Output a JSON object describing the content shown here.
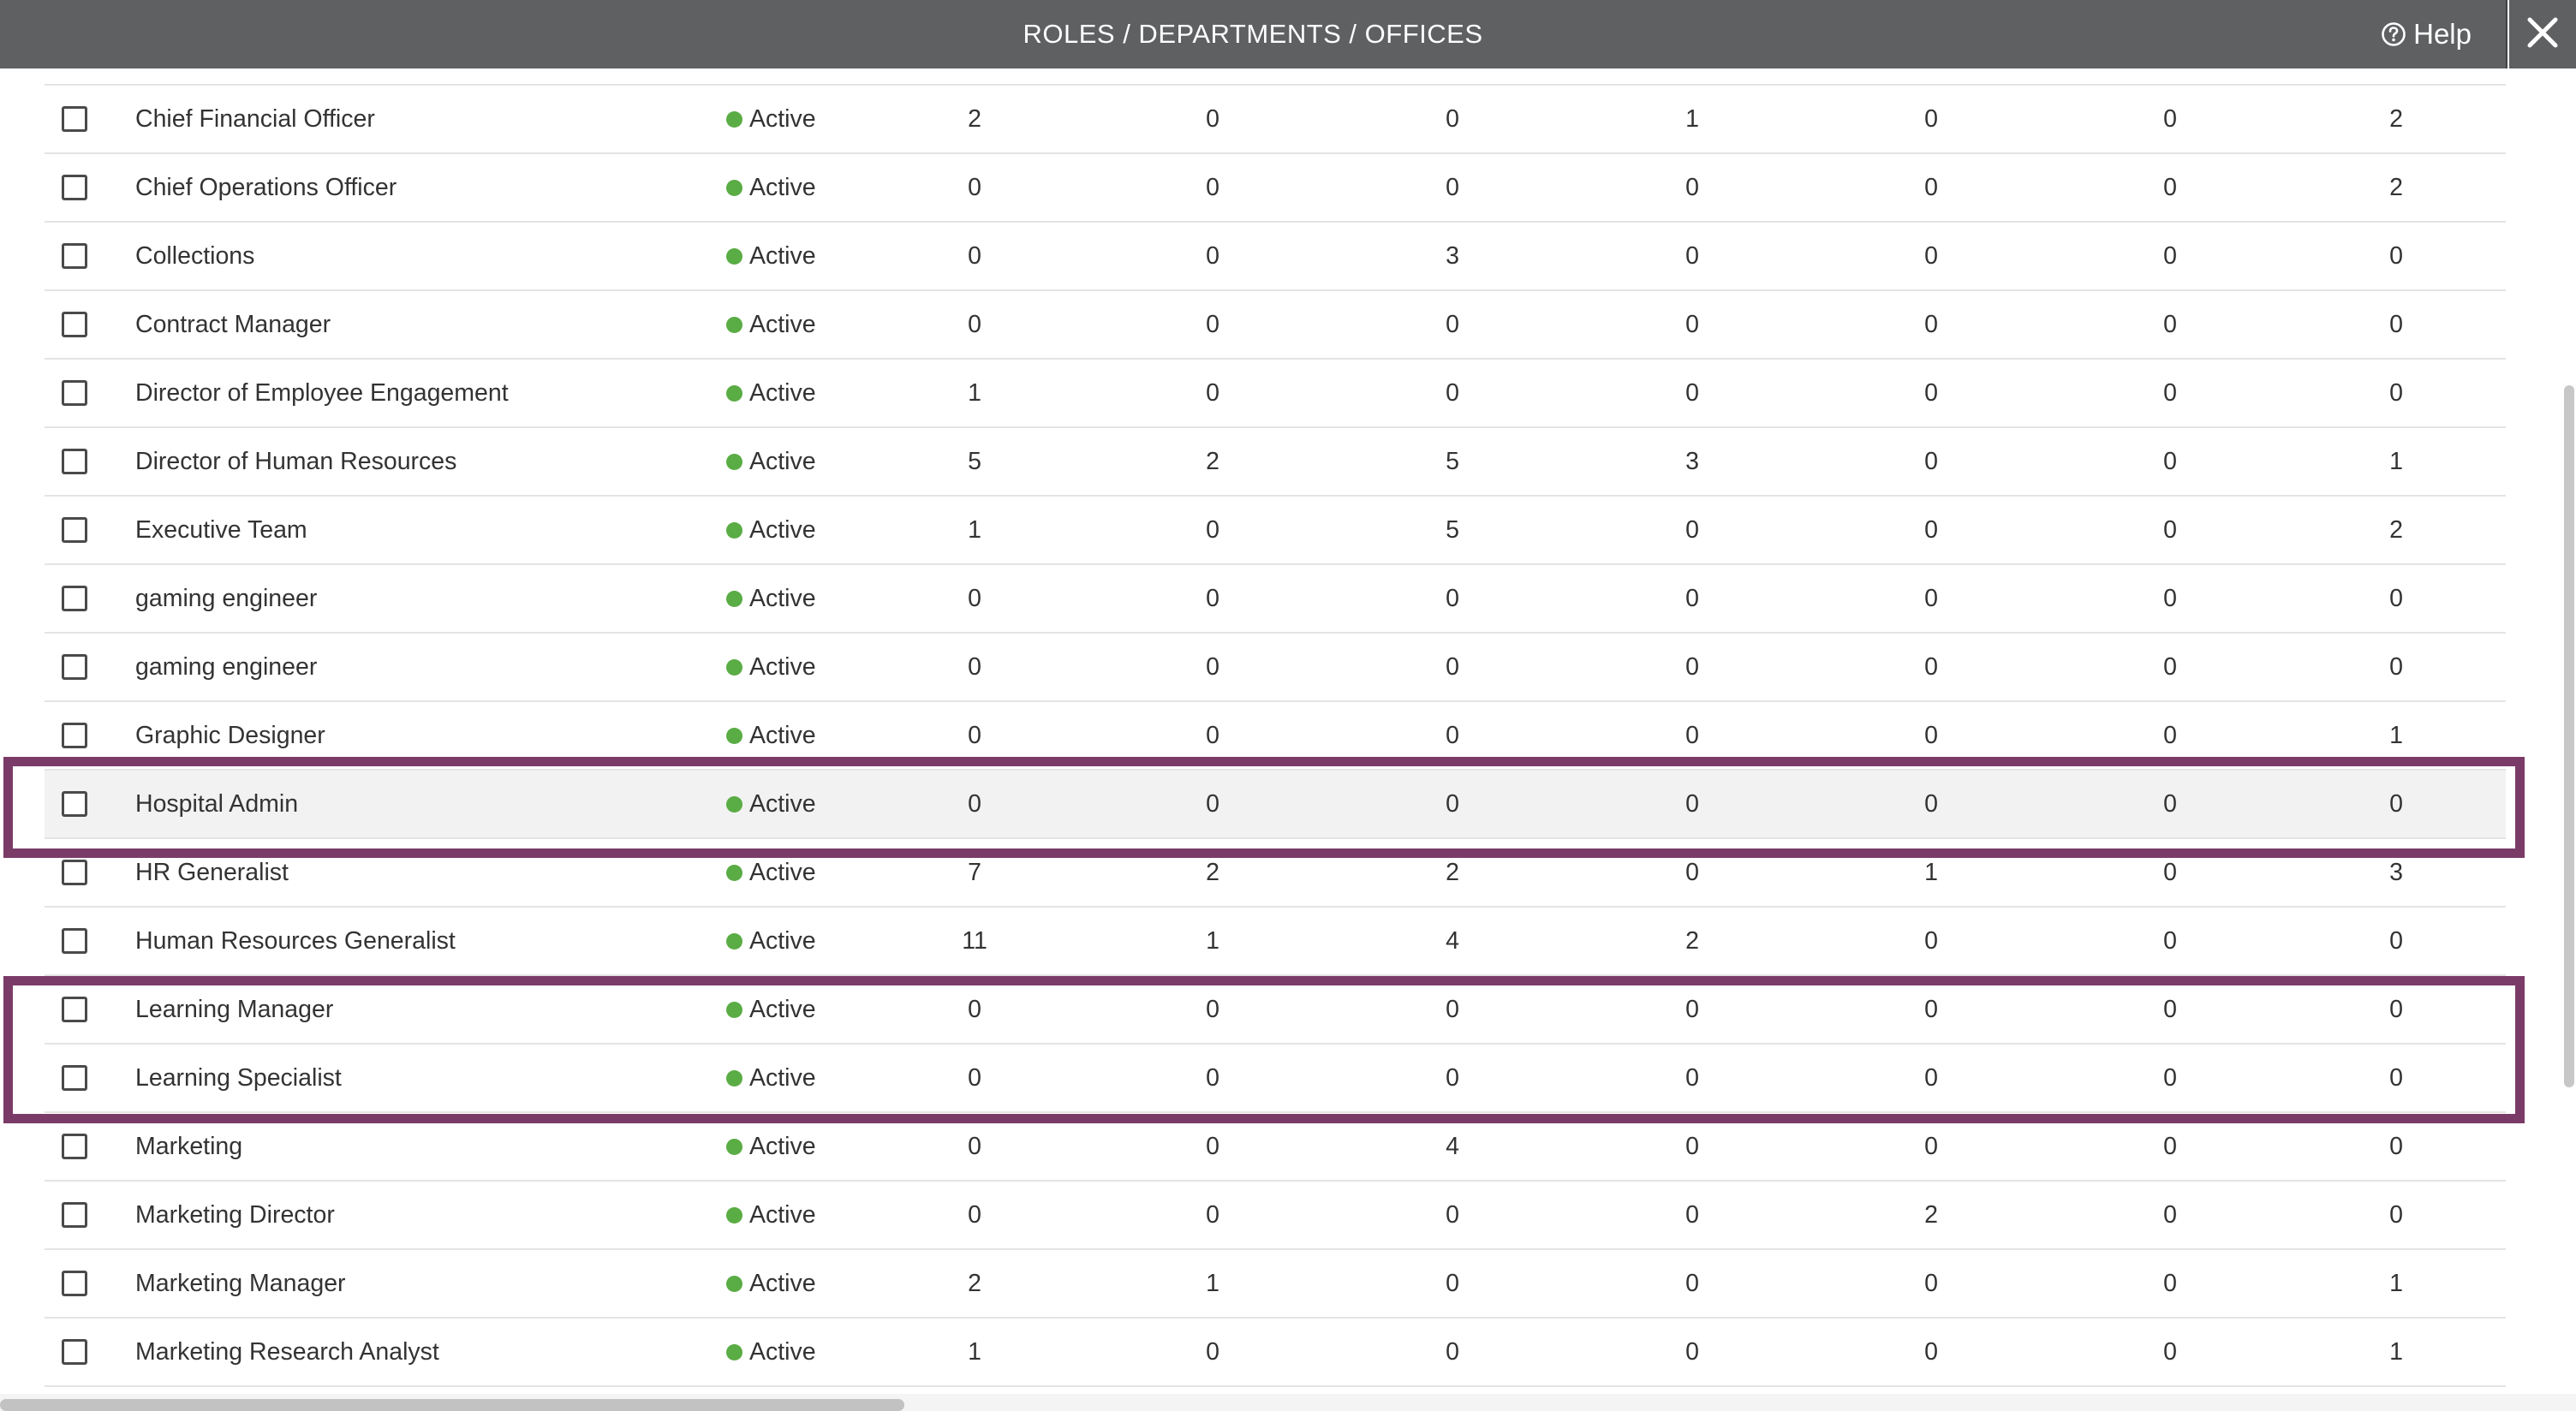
{
  "modal": {
    "title": "ROLES / DEPARTMENTS / OFFICES",
    "help_label": "Help",
    "help_icon": "question-circle-icon",
    "close_icon": "close-icon"
  },
  "colors": {
    "titlebar_bg": "#5f6062",
    "status_active": "#5aac44",
    "highlight_border": "#7b3b68",
    "selected_row_bg": "#f2f2f2"
  },
  "rows": [
    {
      "name": "Chief Financial Officer",
      "status": "Active",
      "values": [
        "2",
        "0",
        "0",
        "1",
        "0",
        "0",
        "2"
      ]
    },
    {
      "name": "Chief Operations Officer",
      "status": "Active",
      "values": [
        "0",
        "0",
        "0",
        "0",
        "0",
        "0",
        "2"
      ]
    },
    {
      "name": "Collections",
      "status": "Active",
      "values": [
        "0",
        "0",
        "3",
        "0",
        "0",
        "0",
        "0"
      ]
    },
    {
      "name": "Contract Manager",
      "status": "Active",
      "values": [
        "0",
        "0",
        "0",
        "0",
        "0",
        "0",
        "0"
      ]
    },
    {
      "name": "Director of Employee Engagement",
      "status": "Active",
      "values": [
        "1",
        "0",
        "0",
        "0",
        "0",
        "0",
        "0"
      ]
    },
    {
      "name": "Director of Human Resources",
      "status": "Active",
      "values": [
        "5",
        "2",
        "5",
        "3",
        "0",
        "0",
        "1"
      ]
    },
    {
      "name": "Executive Team",
      "status": "Active",
      "values": [
        "1",
        "0",
        "5",
        "0",
        "0",
        "0",
        "2"
      ]
    },
    {
      "name": "gaming engineer",
      "status": "Active",
      "values": [
        "0",
        "0",
        "0",
        "0",
        "0",
        "0",
        "0"
      ]
    },
    {
      "name": "gaming engineer",
      "status": "Active",
      "values": [
        "0",
        "0",
        "0",
        "0",
        "0",
        "0",
        "0"
      ]
    },
    {
      "name": "Graphic Designer",
      "status": "Active",
      "values": [
        "0",
        "0",
        "0",
        "0",
        "0",
        "0",
        "1"
      ]
    },
    {
      "name": "Hospital Admin",
      "status": "Active",
      "values": [
        "0",
        "0",
        "0",
        "0",
        "0",
        "0",
        "0"
      ]
    },
    {
      "name": "HR Generalist",
      "status": "Active",
      "values": [
        "7",
        "2",
        "2",
        "0",
        "1",
        "0",
        "3"
      ]
    },
    {
      "name": "Human Resources Generalist",
      "status": "Active",
      "values": [
        "11",
        "1",
        "4",
        "2",
        "0",
        "0",
        "0"
      ]
    },
    {
      "name": "Learning Manager",
      "status": "Active",
      "values": [
        "0",
        "0",
        "0",
        "0",
        "0",
        "0",
        "0"
      ]
    },
    {
      "name": "Learning Specialist",
      "status": "Active",
      "values": [
        "0",
        "0",
        "0",
        "0",
        "0",
        "0",
        "0"
      ]
    },
    {
      "name": "Marketing",
      "status": "Active",
      "values": [
        "0",
        "0",
        "4",
        "0",
        "0",
        "0",
        "0"
      ]
    },
    {
      "name": "Marketing Director",
      "status": "Active",
      "values": [
        "0",
        "0",
        "0",
        "0",
        "2",
        "0",
        "0"
      ]
    },
    {
      "name": "Marketing Manager",
      "status": "Active",
      "values": [
        "2",
        "1",
        "0",
        "0",
        "0",
        "0",
        "1"
      ]
    },
    {
      "name": "Marketing Research Analyst",
      "status": "Active",
      "values": [
        "1",
        "0",
        "0",
        "0",
        "0",
        "0",
        "1"
      ]
    }
  ]
}
